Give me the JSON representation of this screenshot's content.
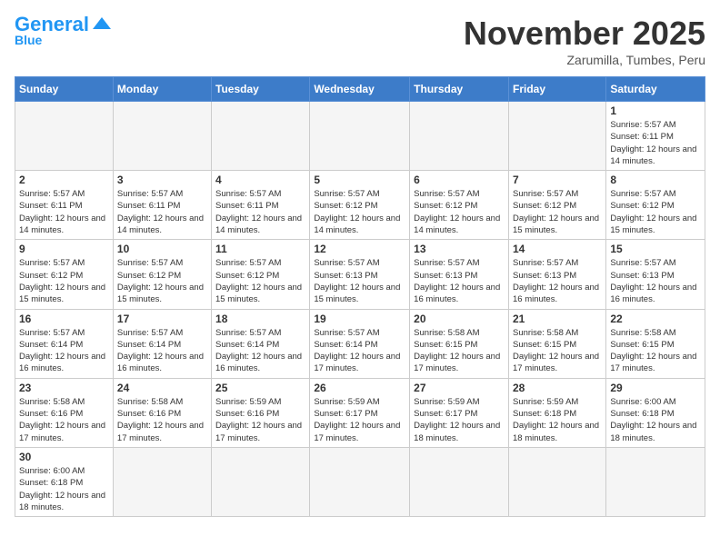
{
  "header": {
    "logo_general": "General",
    "logo_blue": "Blue",
    "month_title": "November 2025",
    "subtitle": "Zarumilla, Tumbes, Peru"
  },
  "days_of_week": [
    "Sunday",
    "Monday",
    "Tuesday",
    "Wednesday",
    "Thursday",
    "Friday",
    "Saturday"
  ],
  "weeks": [
    [
      {
        "day": "",
        "empty": true
      },
      {
        "day": "",
        "empty": true
      },
      {
        "day": "",
        "empty": true
      },
      {
        "day": "",
        "empty": true
      },
      {
        "day": "",
        "empty": true
      },
      {
        "day": "",
        "empty": true
      },
      {
        "day": "1",
        "info": "Sunrise: 5:57 AM\nSunset: 6:11 PM\nDaylight: 12 hours and 14 minutes."
      }
    ],
    [
      {
        "day": "2",
        "info": "Sunrise: 5:57 AM\nSunset: 6:11 PM\nDaylight: 12 hours and 14 minutes."
      },
      {
        "day": "3",
        "info": "Sunrise: 5:57 AM\nSunset: 6:11 PM\nDaylight: 12 hours and 14 minutes."
      },
      {
        "day": "4",
        "info": "Sunrise: 5:57 AM\nSunset: 6:11 PM\nDaylight: 12 hours and 14 minutes."
      },
      {
        "day": "5",
        "info": "Sunrise: 5:57 AM\nSunset: 6:12 PM\nDaylight: 12 hours and 14 minutes."
      },
      {
        "day": "6",
        "info": "Sunrise: 5:57 AM\nSunset: 6:12 PM\nDaylight: 12 hours and 14 minutes."
      },
      {
        "day": "7",
        "info": "Sunrise: 5:57 AM\nSunset: 6:12 PM\nDaylight: 12 hours and 15 minutes."
      },
      {
        "day": "8",
        "info": "Sunrise: 5:57 AM\nSunset: 6:12 PM\nDaylight: 12 hours and 15 minutes."
      }
    ],
    [
      {
        "day": "9",
        "info": "Sunrise: 5:57 AM\nSunset: 6:12 PM\nDaylight: 12 hours and 15 minutes."
      },
      {
        "day": "10",
        "info": "Sunrise: 5:57 AM\nSunset: 6:12 PM\nDaylight: 12 hours and 15 minutes."
      },
      {
        "day": "11",
        "info": "Sunrise: 5:57 AM\nSunset: 6:12 PM\nDaylight: 12 hours and 15 minutes."
      },
      {
        "day": "12",
        "info": "Sunrise: 5:57 AM\nSunset: 6:13 PM\nDaylight: 12 hours and 15 minutes."
      },
      {
        "day": "13",
        "info": "Sunrise: 5:57 AM\nSunset: 6:13 PM\nDaylight: 12 hours and 16 minutes."
      },
      {
        "day": "14",
        "info": "Sunrise: 5:57 AM\nSunset: 6:13 PM\nDaylight: 12 hours and 16 minutes."
      },
      {
        "day": "15",
        "info": "Sunrise: 5:57 AM\nSunset: 6:13 PM\nDaylight: 12 hours and 16 minutes."
      }
    ],
    [
      {
        "day": "16",
        "info": "Sunrise: 5:57 AM\nSunset: 6:14 PM\nDaylight: 12 hours and 16 minutes."
      },
      {
        "day": "17",
        "info": "Sunrise: 5:57 AM\nSunset: 6:14 PM\nDaylight: 12 hours and 16 minutes."
      },
      {
        "day": "18",
        "info": "Sunrise: 5:57 AM\nSunset: 6:14 PM\nDaylight: 12 hours and 16 minutes."
      },
      {
        "day": "19",
        "info": "Sunrise: 5:57 AM\nSunset: 6:14 PM\nDaylight: 12 hours and 17 minutes."
      },
      {
        "day": "20",
        "info": "Sunrise: 5:58 AM\nSunset: 6:15 PM\nDaylight: 12 hours and 17 minutes."
      },
      {
        "day": "21",
        "info": "Sunrise: 5:58 AM\nSunset: 6:15 PM\nDaylight: 12 hours and 17 minutes."
      },
      {
        "day": "22",
        "info": "Sunrise: 5:58 AM\nSunset: 6:15 PM\nDaylight: 12 hours and 17 minutes."
      }
    ],
    [
      {
        "day": "23",
        "info": "Sunrise: 5:58 AM\nSunset: 6:16 PM\nDaylight: 12 hours and 17 minutes."
      },
      {
        "day": "24",
        "info": "Sunrise: 5:58 AM\nSunset: 6:16 PM\nDaylight: 12 hours and 17 minutes."
      },
      {
        "day": "25",
        "info": "Sunrise: 5:59 AM\nSunset: 6:16 PM\nDaylight: 12 hours and 17 minutes."
      },
      {
        "day": "26",
        "info": "Sunrise: 5:59 AM\nSunset: 6:17 PM\nDaylight: 12 hours and 17 minutes."
      },
      {
        "day": "27",
        "info": "Sunrise: 5:59 AM\nSunset: 6:17 PM\nDaylight: 12 hours and 18 minutes."
      },
      {
        "day": "28",
        "info": "Sunrise: 5:59 AM\nSunset: 6:18 PM\nDaylight: 12 hours and 18 minutes."
      },
      {
        "day": "29",
        "info": "Sunrise: 6:00 AM\nSunset: 6:18 PM\nDaylight: 12 hours and 18 minutes."
      }
    ],
    [
      {
        "day": "30",
        "info": "Sunrise: 6:00 AM\nSunset: 6:18 PM\nDaylight: 12 hours and 18 minutes."
      },
      {
        "day": "",
        "empty": true
      },
      {
        "day": "",
        "empty": true
      },
      {
        "day": "",
        "empty": true
      },
      {
        "day": "",
        "empty": true
      },
      {
        "day": "",
        "empty": true
      },
      {
        "day": "",
        "empty": true
      }
    ]
  ]
}
